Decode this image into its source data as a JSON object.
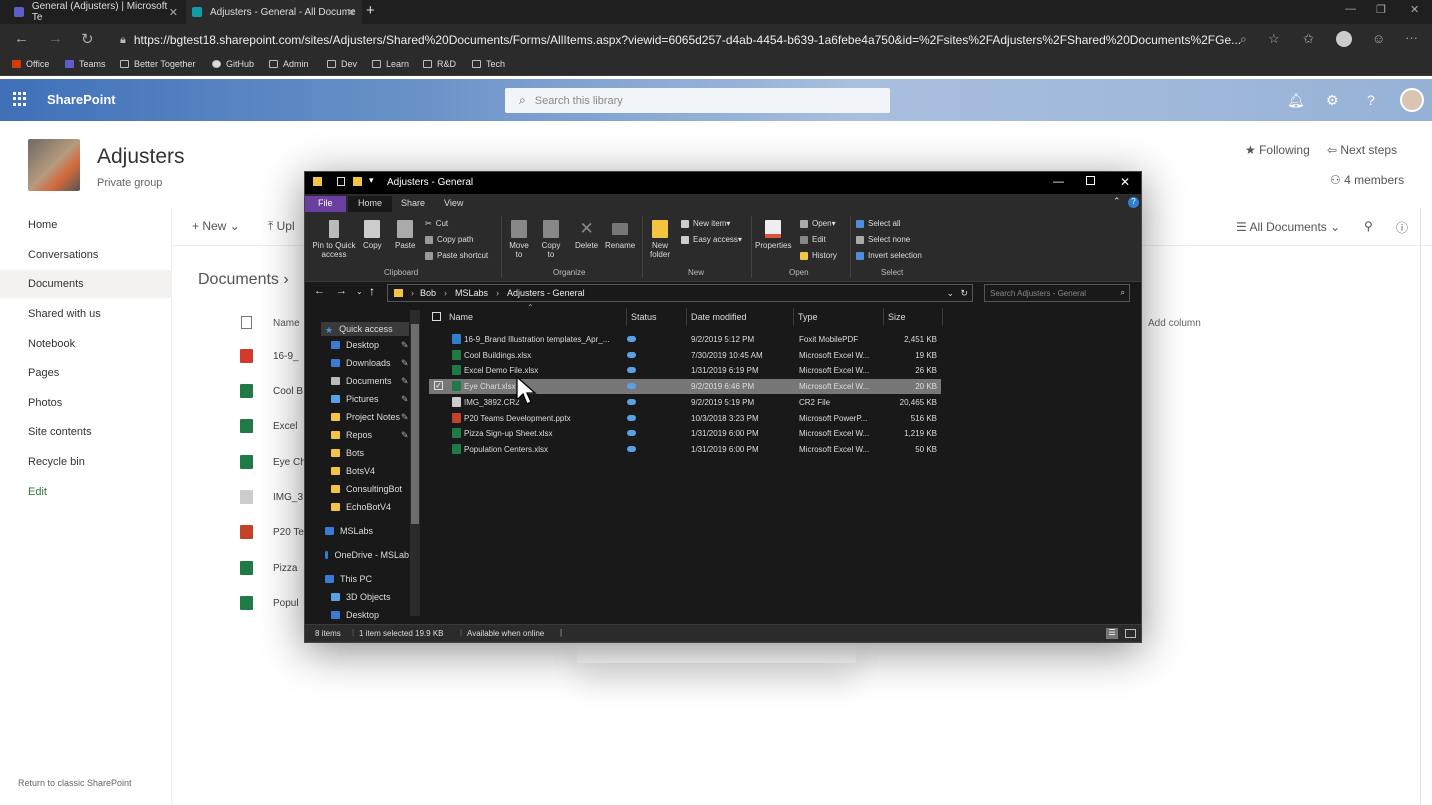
{
  "browser": {
    "tabs": [
      {
        "label": "General (Adjusters) | Microsoft Te"
      },
      {
        "label": "Adjusters - General - All Docume"
      }
    ],
    "url": "https://bgtest18.sharepoint.com/sites/Adjusters/Shared%20Documents/Forms/AllItems.aspx?viewid=6065d257-d4ab-4454-b639-1a6febe4a750&id=%2Fsites%2FAdjusters%2FShared%20Documents%2FGe...",
    "favorites": [
      "Office",
      "Teams",
      "Better Together",
      "GitHub",
      "Admin",
      "Dev",
      "Learn",
      "R&D",
      "Tech"
    ]
  },
  "sharepoint": {
    "brand": "SharePoint",
    "search_placeholder": "Search this library",
    "site_name": "Adjusters",
    "privacy": "Private group",
    "following": "Following",
    "next_steps": "Next steps",
    "members": "4 members",
    "nav": [
      "Home",
      "Conversations",
      "Documents",
      "Shared with us",
      "Notebook",
      "Pages",
      "Photos",
      "Site contents",
      "Recycle bin",
      "Edit"
    ],
    "return_classic": "Return to classic SharePoint",
    "cmd_new": "New",
    "cmd_upload": "Upl",
    "view_name": "All Documents",
    "breadcrumb": "Documents",
    "col_name": "Name",
    "add_column": "Add column",
    "bg_rows": [
      "16-9_",
      "Cool B",
      "Excel",
      "Eye Ch",
      "IMG_3",
      "P20 Te",
      "Pizza",
      "Popul"
    ]
  },
  "explorer": {
    "title": "Adjusters - General",
    "tabs": [
      "File",
      "Home",
      "Share",
      "View"
    ],
    "ribbon": {
      "pin": "Pin to Quick access",
      "copy": "Copy",
      "paste": "Paste",
      "cut": "Cut",
      "copy_path": "Copy path",
      "paste_shortcut": "Paste shortcut",
      "clipboard": "Clipboard",
      "move_to": "Move to",
      "copy_to": "Copy to",
      "delete": "Delete",
      "rename": "Rename",
      "organize": "Organize",
      "new_folder": "New folder",
      "new_item": "New item",
      "easy_access": "Easy access",
      "new_group": "New",
      "properties": "Properties",
      "open_btn": "Open",
      "edit": "Edit",
      "history": "History",
      "open_group": "Open",
      "select_all": "Select all",
      "select_none": "Select none",
      "invert": "Invert selection",
      "select_group": "Select"
    },
    "path": [
      "Bob",
      "MSLabs",
      "Adjusters - General"
    ],
    "search_placeholder": "Search Adjusters - General",
    "nav_tree": [
      "Quick access",
      "Desktop",
      "Downloads",
      "Documents",
      "Pictures",
      "Project Notes",
      "Repos",
      "Bots",
      "BotsV4",
      "ConsultingBot",
      "EchoBotV4",
      "MSLabs",
      "OneDrive - MSLab",
      "This PC",
      "3D Objects",
      "Desktop"
    ],
    "columns": [
      "Name",
      "Status",
      "Date modified",
      "Type",
      "Size"
    ],
    "files": [
      {
        "name": "16-9_Brand Illustration templates_Apr_...",
        "date": "9/2/2019 5:12 PM",
        "type": "Foxit MobilePDF",
        "size": "2,451 KB",
        "color": "#2f7fd0"
      },
      {
        "name": "Cool Buildings.xlsx",
        "date": "7/30/2019 10:45 AM",
        "type": "Microsoft Excel W...",
        "size": "19 KB",
        "color": "#1f7a45"
      },
      {
        "name": "Excel Demo File.xlsx",
        "date": "1/31/2019 6:19 PM",
        "type": "Microsoft Excel W...",
        "size": "26 KB",
        "color": "#1f7a45"
      },
      {
        "name": "Eye Chart.xlsx",
        "date": "9/2/2019 6:46 PM",
        "type": "Microsoft Excel W...",
        "size": "20 KB",
        "color": "#1f7a45"
      },
      {
        "name": "IMG_3892.CR2",
        "date": "9/2/2019 5:19 PM",
        "type": "CR2 File",
        "size": "20,465 KB",
        "color": "#cccccc"
      },
      {
        "name": "P20 Teams Development.pptx",
        "date": "10/3/2018 3:23 PM",
        "type": "Microsoft PowerP...",
        "size": "516 KB",
        "color": "#c2432a"
      },
      {
        "name": "Pizza Sign-up Sheet.xlsx",
        "date": "1/31/2019 6:00 PM",
        "type": "Microsoft Excel W...",
        "size": "1,219 KB",
        "color": "#1f7a45"
      },
      {
        "name": "Population Centers.xlsx",
        "date": "1/31/2019 6:00 PM",
        "type": "Microsoft Excel W...",
        "size": "50 KB",
        "color": "#1f7a45"
      }
    ],
    "status": {
      "count": "8 items",
      "selected": "1 item selected  19.9 KB",
      "availability": "Available when online"
    }
  }
}
